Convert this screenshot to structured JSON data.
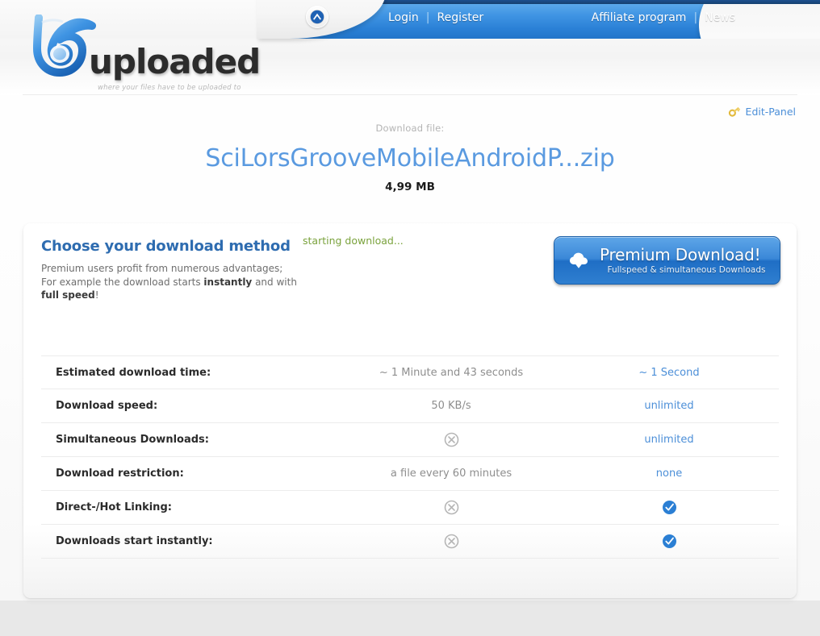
{
  "header": {
    "collapse_button_icon": "chevron-up-icon",
    "nav_left": [
      {
        "label": "Login"
      },
      {
        "label": "Register"
      }
    ],
    "nav_right": [
      {
        "label": "Affiliate program"
      },
      {
        "label": "News"
      }
    ],
    "separator": "|",
    "logo_word": "uploaded",
    "logo_tagline": "where your files have to be uploaded to",
    "colors": {
      "ribbon_top": "#64b0ee",
      "ribbon_bottom": "#2275c9",
      "strip": "#1d4f8f"
    }
  },
  "edit_panel": {
    "label": "Edit-Panel",
    "icon": "key-icon",
    "color": "#4c8fd8"
  },
  "file": {
    "label": "Download file:",
    "name": "SciLorsGrooveMobileAndroidP...zip",
    "size": "4,99 MB"
  },
  "card": {
    "title": "Choose your download method",
    "desc_line1": "Premium users profit from numerous advantages;",
    "desc_line2_a": "For example the download starts ",
    "desc_line2_b": "instantly",
    "desc_line2_c": " and with",
    "desc_line3_a": "full speed",
    "desc_line3_b": "!",
    "status": "starting download...",
    "status_color": "#7aa23c"
  },
  "premium_button": {
    "title": "Premium Download!",
    "subtitle": "Fullspeed & simultaneous Downloads",
    "icon": "cloud-download-icon",
    "color": "#2f7fd0"
  },
  "comparison": {
    "rows": [
      {
        "feature": "Estimated download time:",
        "free": "~ 1 Minute and 43 seconds",
        "free_type": "text",
        "premium": "~ 1 Second",
        "premium_type": "text"
      },
      {
        "feature": "Download speed:",
        "free": "50 KB/s",
        "free_type": "text",
        "premium": "unlimited",
        "premium_type": "text"
      },
      {
        "feature": "Simultaneous Downloads:",
        "free": "cross-circle-icon",
        "free_type": "icon",
        "premium": "unlimited",
        "premium_type": "text"
      },
      {
        "feature": "Download restriction:",
        "free": "a file every 60 minutes",
        "free_type": "text",
        "premium": "none",
        "premium_type": "text"
      },
      {
        "feature": "Direct-/Hot Linking:",
        "free": "cross-circle-icon",
        "free_type": "icon",
        "premium": "check-circle-icon",
        "premium_type": "icon"
      },
      {
        "feature": "Downloads start instantly:",
        "free": "cross-circle-icon",
        "free_type": "icon",
        "premium": "check-circle-icon",
        "premium_type": "icon"
      }
    ],
    "icon_colors": {
      "cross": "#b6b6b6",
      "check": "#2b7fd4"
    }
  }
}
